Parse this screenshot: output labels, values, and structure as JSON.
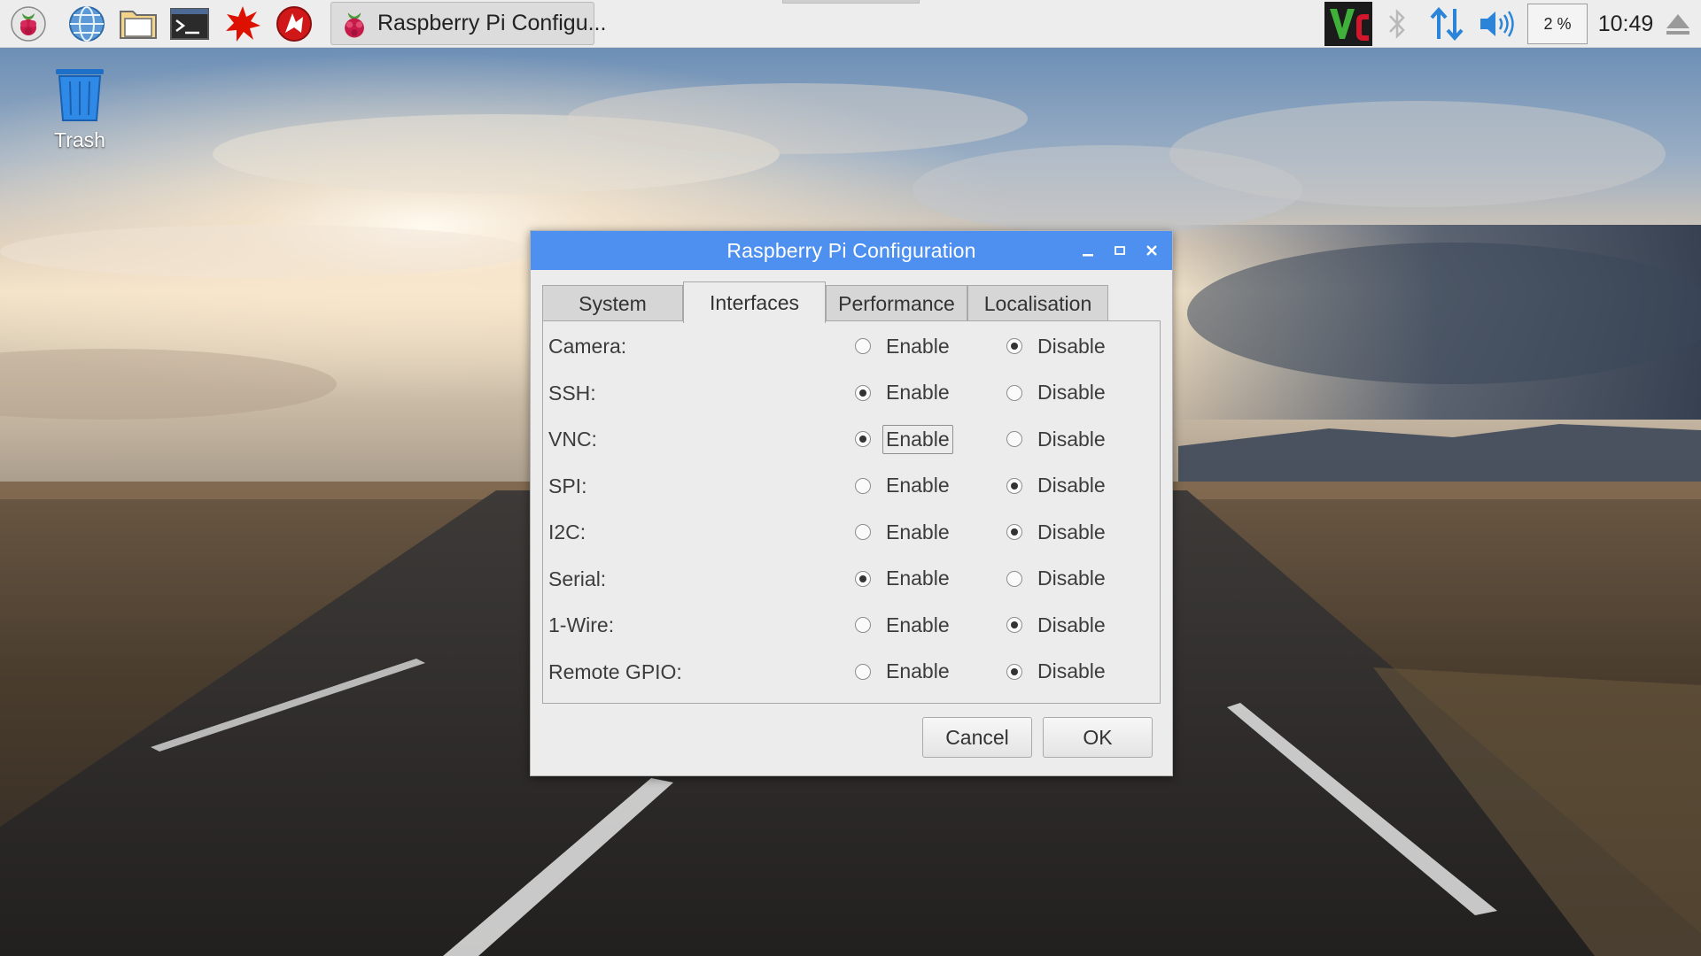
{
  "taskbar": {
    "window_button_label": "Raspberry Pi Configu...",
    "cpu_usage": "2 %",
    "clock": "10:49",
    "launchers": [
      "raspberry-menu-icon",
      "web-browser-icon",
      "file-manager-icon",
      "terminal-icon",
      "wolfram-icon",
      "mathematica-icon"
    ],
    "tray_icons": [
      "vnc-icon",
      "bluetooth-icon",
      "network-icon",
      "volume-icon",
      "eject-icon"
    ]
  },
  "desktop": {
    "trash_label": "Trash"
  },
  "dialog": {
    "title": "Raspberry Pi Configuration",
    "tabs": [
      {
        "label": "System",
        "active": false
      },
      {
        "label": "Interfaces",
        "active": true
      },
      {
        "label": "Performance",
        "active": false
      },
      {
        "label": "Localisation",
        "active": false
      }
    ],
    "rows": [
      {
        "label": "Camera:",
        "enable": "Enable",
        "disable": "Disable",
        "selected": "disable"
      },
      {
        "label": "SSH:",
        "enable": "Enable",
        "disable": "Disable",
        "selected": "enable"
      },
      {
        "label": "VNC:",
        "enable": "Enable",
        "disable": "Disable",
        "selected": "enable"
      },
      {
        "label": "SPI:",
        "enable": "Enable",
        "disable": "Disable",
        "selected": "disable"
      },
      {
        "label": "I2C:",
        "enable": "Enable",
        "disable": "Disable",
        "selected": "disable"
      },
      {
        "label": "Serial:",
        "enable": "Enable",
        "disable": "Disable",
        "selected": "enable"
      },
      {
        "label": "1-Wire:",
        "enable": "Enable",
        "disable": "Disable",
        "selected": "disable"
      },
      {
        "label": "Remote GPIO:",
        "enable": "Enable",
        "disable": "Disable",
        "selected": "disable"
      }
    ],
    "cancel_label": "Cancel",
    "ok_label": "OK"
  },
  "colors": {
    "titlebar": "#4d90ef",
    "taskbar": "#ededed",
    "dialog_bg": "#ececec"
  }
}
